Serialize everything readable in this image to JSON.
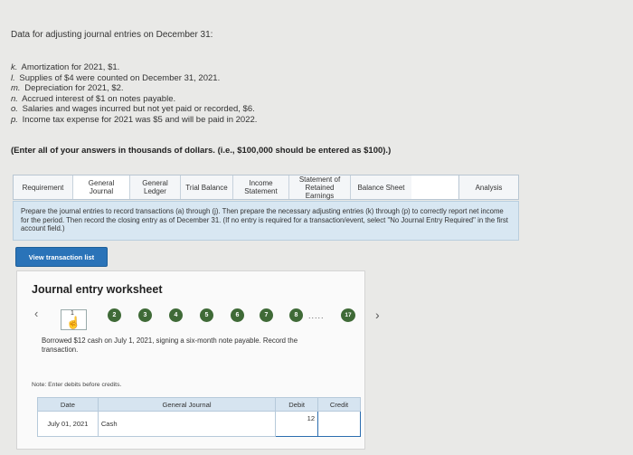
{
  "intro": "Data for adjusting journal entries on December 31:",
  "adjustments": [
    {
      "letter": "k.",
      "text": "Amortization for 2021, $1."
    },
    {
      "letter": "l.",
      "text": "Supplies of $4 were counted on December 31, 2021."
    },
    {
      "letter": "m.",
      "text": "Depreciation for 2021, $2."
    },
    {
      "letter": "n.",
      "text": "Accrued interest of $1 on notes payable."
    },
    {
      "letter": "o.",
      "text": "Salaries and wages incurred but not yet paid or recorded, $6."
    },
    {
      "letter": "p.",
      "text": "Income tax expense for 2021 was $5 and will be paid in 2022."
    }
  ],
  "enter_note": "(Enter all of your answers in thousands of dollars. (i.e., $100,000 should be entered as $100).)",
  "tabs": [
    "Requirement",
    "General Journal",
    "General Ledger",
    "Trial Balance",
    "Income Statement",
    "Statement of Retained Earnings",
    "Balance Sheet",
    "Analysis"
  ],
  "instructions": "Prepare the journal entries to record transactions (a) through (j). Then prepare the necessary adjusting entries (k) through (p) to correctly report net income for the period. Then record the closing entry as of December 31. (If no entry is required for a transaction/event, select \"No Journal Entry Required\" in the first account field.)",
  "view_button": "View transaction list",
  "worksheet": {
    "title": "Journal entry worksheet",
    "steps": [
      "1",
      "2",
      "3",
      "4",
      "5",
      "6",
      "7",
      "8"
    ],
    "dots": ".....",
    "last_step": "17",
    "transaction": "Borrowed $12 cash on July 1, 2021, signing a six-month note payable. Record the transaction.",
    "note": "Note: Enter debits before credits.",
    "table": {
      "headers": [
        "Date",
        "General Journal",
        "Debit",
        "Credit"
      ],
      "row": {
        "date": "July 01, 2021",
        "account": "Cash",
        "debit": "12",
        "credit": ""
      }
    }
  }
}
